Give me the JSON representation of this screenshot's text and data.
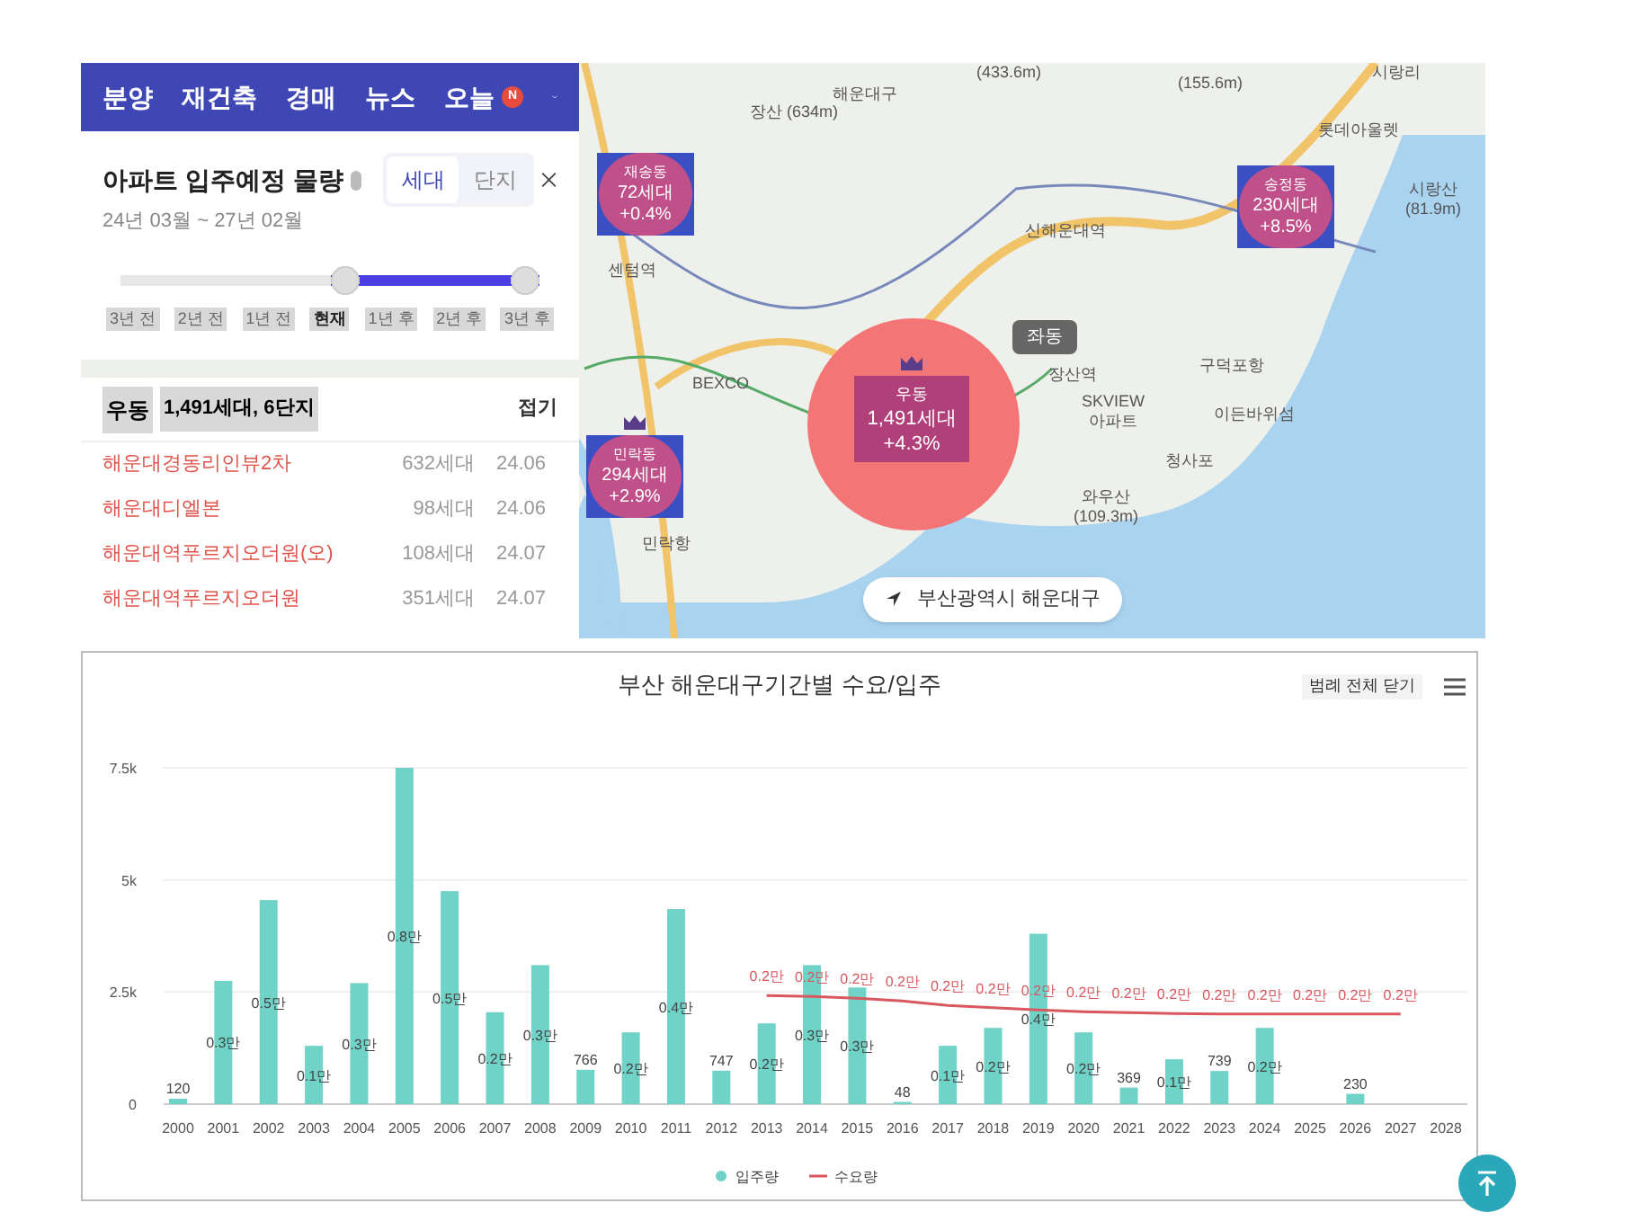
{
  "nav": {
    "items": [
      {
        "label": "분양"
      },
      {
        "label": "재건축"
      },
      {
        "label": "경매"
      },
      {
        "label": "뉴스"
      },
      {
        "label": "오늘",
        "badge": "N"
      }
    ]
  },
  "panel": {
    "title": "아파트 입주예정 물량",
    "period": "24년 03월 ~ 27년 02월",
    "toggle": [
      {
        "label": "세대",
        "selected": true
      },
      {
        "label": "단지",
        "selected": false
      }
    ],
    "slider": {
      "level": 0.5,
      "ticks": [
        {
          "label": "3년 전",
          "selected": false
        },
        {
          "label": "2년 전",
          "selected": false
        },
        {
          "label": "1년 전",
          "selected": false
        },
        {
          "label": "현재",
          "selected": true
        },
        {
          "label": "1년 후",
          "selected": false
        },
        {
          "label": "2년 후",
          "selected": false
        },
        {
          "label": "3년 후",
          "selected": false
        }
      ]
    }
  },
  "list": {
    "district": "우동",
    "summary": "1,491세대, 6단지",
    "collapse": "접기",
    "rows": [
      {
        "name": "해운대경동리인뷰2차",
        "units": "632세대",
        "date": "24.06"
      },
      {
        "name": "해운대디엘본",
        "units": "98세대",
        "date": "24.06"
      },
      {
        "name": "해운대역푸르지오더원(오)",
        "units": "108세대",
        "date": "24.07"
      },
      {
        "name": "해운대역푸르지오더원",
        "units": "351세대",
        "date": "24.07"
      }
    ]
  },
  "map": {
    "labels": [
      "해운대구",
      "장산 (634m)",
      "(433.6m)",
      "(155.6m)",
      "시랑리",
      "롯데아울렛",
      "시랑산 (81.9m)",
      "센텀역",
      "신해운대역",
      "BEXCO",
      "장산역",
      "SKVIEW 아파트",
      "구덕포항",
      "이든바위섬",
      "청사포",
      "와우산 (109.3m)",
      "민락항"
    ],
    "markers": [
      {
        "kind": "small",
        "name": "재송동",
        "units": "72세대",
        "change": "+0.4%",
        "crown": false
      },
      {
        "kind": "small",
        "name": "송정동",
        "units": "230세대",
        "change": "+8.5%",
        "crown": false
      },
      {
        "kind": "small",
        "name": "민락동",
        "units": "294세대",
        "change": "+2.9%",
        "crown": true
      },
      {
        "kind": "big",
        "name": "우동",
        "units": "1,491세대",
        "change": "+4.3%",
        "crown": true
      }
    ],
    "area_tag": "좌동",
    "location": "부산광역시 해운대구"
  },
  "chart": {
    "legend_toggle": "범례 전체 닫기",
    "bar_labels": [
      "120",
      "0.3만",
      "0.5만",
      "0.1만",
      "0.3만",
      "0.8만",
      "0.5만",
      "0.2만",
      "0.3만",
      "766",
      "0.2만",
      "0.4만",
      "747",
      "0.2만",
      "0.3만",
      "0.3만",
      "48",
      "0.1만",
      "0.2만",
      "0.4만",
      "0.2만",
      "369",
      "0.1만",
      "739",
      "0.2만",
      "230"
    ],
    "line_labels": [
      "0.2만",
      "0.2만",
      "0.2만",
      "0.2만",
      "0.2만",
      "0.2만",
      "0.2만",
      "0.2만",
      "0.2만",
      "0.2만",
      "0.2만",
      "0.2만",
      "0.2만",
      "0.2만",
      "0.2만"
    ],
    "chart_data": {
      "type": "bar",
      "title": "부산 해운대구기간별 수요/입주",
      "stacked": false,
      "grid": true,
      "legend": "bottom",
      "ylim": [
        0,
        7500
      ],
      "categories": [
        "2000",
        "2001",
        "2002",
        "2003",
        "2004",
        "2005",
        "2006",
        "2007",
        "2008",
        "2009",
        "2010",
        "2011",
        "2012",
        "2013",
        "2014",
        "2015",
        "2016",
        "2017",
        "2018",
        "2019",
        "2020",
        "2021",
        "2022",
        "2023",
        "2024",
        "2025",
        "2026",
        "2027",
        "2028"
      ],
      "yticks": [
        0,
        {
          "value": 2500,
          "label": "2.5k"
        },
        {
          "value": 5000,
          "label": "5k"
        },
        {
          "value": 7500,
          "label": "7.5k"
        }
      ],
      "series": [
        {
          "name": "입주량",
          "type": "bar",
          "color": "#6fd3c8",
          "values": [
            120,
            2750,
            4550,
            1300,
            2700,
            7500,
            4750,
            2050,
            3100,
            766,
            1600,
            4350,
            747,
            1800,
            3100,
            2600,
            48,
            1300,
            1700,
            3800,
            1600,
            369,
            1000,
            739,
            1700,
            null,
            230,
            null,
            null
          ]
        },
        {
          "name": "수요량",
          "type": "line",
          "color": "#d9575f",
          "values": [
            null,
            null,
            null,
            null,
            null,
            null,
            null,
            null,
            null,
            null,
            null,
            null,
            null,
            2420,
            2400,
            2360,
            2300,
            2200,
            2150,
            2100,
            2060,
            2040,
            2020,
            2010,
            2010,
            2010,
            2010,
            2010,
            null
          ]
        }
      ]
    }
  }
}
